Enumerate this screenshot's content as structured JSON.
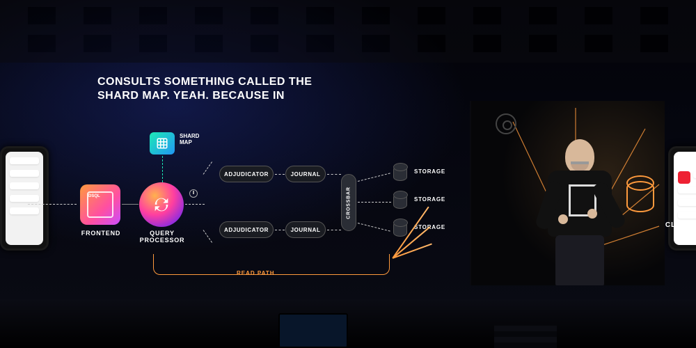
{
  "caption": {
    "line1": "CONSULTS SOMETHING CALLED THE",
    "line2": "SHARD MAP. YEAH. BECAUSE IN"
  },
  "diagram": {
    "frontend": "FRONTEND",
    "query_processor": "QUERY\nPROCESSOR",
    "shard_map": "SHARD\nMAP",
    "adjudicator": "ADJUDICATOR",
    "journal": "JOURNAL",
    "crossbar": "CROSSBAR",
    "storage": "STORAGE",
    "read_path": "READ PATH"
  },
  "right_label": "CLIENT",
  "icons": {
    "frontend": "dsql-icon",
    "query_processor": "sync-icon",
    "shard_map": "grid-icon",
    "clock": "clock-icon",
    "storage": "cylinder-icon"
  },
  "colors": {
    "accent_orange": "#ff9a3d",
    "accent_pink": "#ff3fa0",
    "accent_teal": "#1de9b6"
  }
}
